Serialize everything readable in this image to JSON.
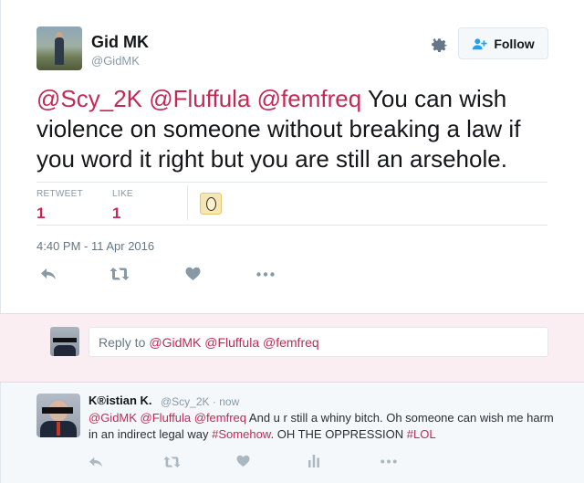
{
  "tweet": {
    "author_name": "Gid MK",
    "author_handle": "@GidMK",
    "follow_label": "Follow",
    "text_mentions": [
      "@Scy_2K",
      "@Fluffula",
      "@femfreq"
    ],
    "text_body": "You can wish violence on someone without breaking a law if you word it right but you are still an arsehole.",
    "stats": {
      "retweet_label": "RETWEET",
      "retweet_count": "1",
      "like_label": "LIKE",
      "like_count": "1"
    },
    "timestamp": "4:40 PM - 11 Apr 2016",
    "icons": [
      "reply-icon",
      "retweet-icon",
      "like-icon",
      "more-icon",
      "gear-icon",
      "follow-user-icon"
    ]
  },
  "reply_box": {
    "prefix": "Reply to",
    "mentions": "@GidMK @Fluffula @femfreq"
  },
  "reply": {
    "author_name": "K®istian K.",
    "author_handle": "@Scy_2K",
    "separator": "·",
    "time": "now",
    "mentions": "@GidMK @Fluffula @femfreq",
    "text_part1": "And u r still a whiny bitch. Oh someone can wish me harm in an indirect legal way",
    "hashtag1": "#Somehow",
    "text_part2": ". OH THE OPPRESSION",
    "hashtag2": "#LOL"
  },
  "colors": {
    "accent": "#c22a55",
    "muted": "#8899a6",
    "reply_band": "#fbeef2"
  }
}
